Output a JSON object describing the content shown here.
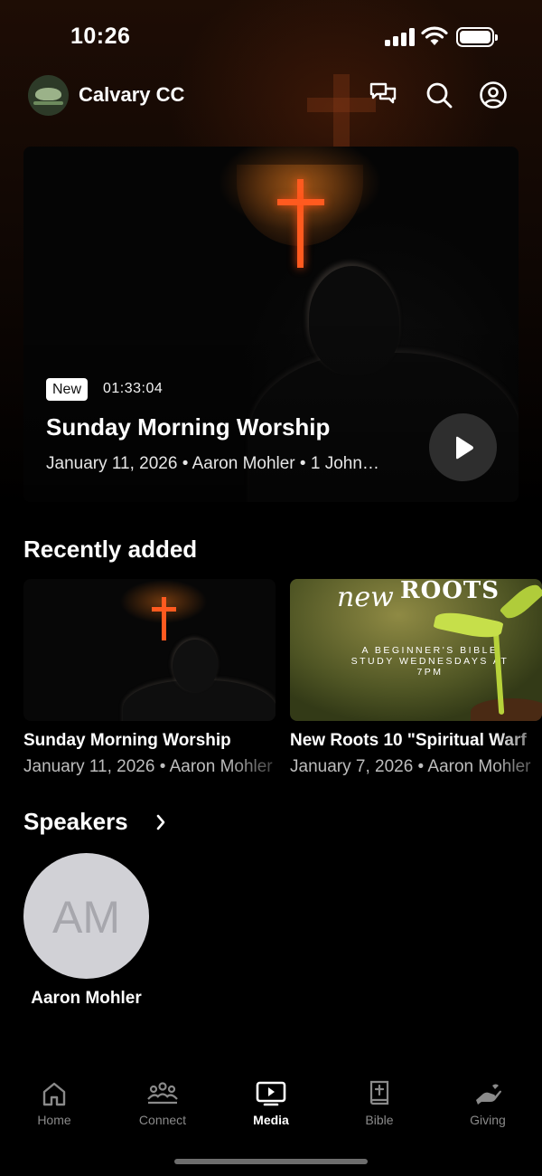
{
  "status_bar": {
    "time": "10:26"
  },
  "header": {
    "org_name": "Calvary CC",
    "icons": [
      "chat-icon",
      "search-icon",
      "profile-icon"
    ]
  },
  "hero": {
    "badge": "New",
    "duration": "01:33:04",
    "title": "Sunday Morning Worship",
    "meta": "January 11, 2026 • Aaron Mohler • 1 John…"
  },
  "recently_added": {
    "title": "Recently added",
    "items": [
      {
        "title": "Sunday Morning Worship",
        "meta": "January 11, 2026 • Aaron Mohler"
      },
      {
        "title": "New Roots 10 \"Spiritual Warf",
        "meta": "January 7, 2026 • Aaron Mohler",
        "thumb_new": "new",
        "thumb_roots": "ROOTS",
        "thumb_sub": "A BEGINNER'S BIBLE STUDY WEDNESDAYS AT 7PM"
      }
    ]
  },
  "speakers": {
    "title": "Speakers",
    "items": [
      {
        "initials": "AM",
        "name": "Aaron Mohler"
      }
    ]
  },
  "tabs": [
    {
      "label": "Home",
      "icon": "home-icon",
      "active": false
    },
    {
      "label": "Connect",
      "icon": "people-icon",
      "active": false
    },
    {
      "label": "Media",
      "icon": "tv-play-icon",
      "active": true
    },
    {
      "label": "Bible",
      "icon": "bible-icon",
      "active": false
    },
    {
      "label": "Giving",
      "icon": "giving-hand-icon",
      "active": false
    }
  ],
  "colors": {
    "accent_cross": "#ff5a1f",
    "background": "#000000",
    "inactive_tab": "#8a8a8a"
  }
}
